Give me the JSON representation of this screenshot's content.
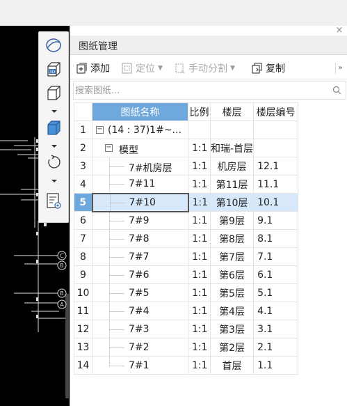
{
  "panel": {
    "title": "图纸管理",
    "close_glyph": "×"
  },
  "toolbar": {
    "add_label": "添加",
    "locate_label": "定位",
    "split_label": "手动分割",
    "copy_label": "复制",
    "more_glyph": "»"
  },
  "search": {
    "placeholder": "搜索图纸..."
  },
  "table": {
    "headers": {
      "name": "图纸名称",
      "scale": "比例",
      "floor": "楼层",
      "floor_no": "楼层编号"
    },
    "rows": [
      {
        "idx": "1",
        "name": "(14 : 37)1#~...",
        "scale": "",
        "floor": "",
        "floor_no": ""
      },
      {
        "idx": "2",
        "name": "模型",
        "scale": "1:1",
        "floor": "和瑞-首层",
        "floor_no": ""
      },
      {
        "idx": "3",
        "name": "7#机房层",
        "scale": "1:1",
        "floor": "机房层",
        "floor_no": "12.1"
      },
      {
        "idx": "4",
        "name": "7#11",
        "scale": "1:1",
        "floor": "第11层",
        "floor_no": "11.1"
      },
      {
        "idx": "5",
        "name": "7#10",
        "scale": "1:1",
        "floor": "第10层",
        "floor_no": "10.1"
      },
      {
        "idx": "6",
        "name": "7#9",
        "scale": "1:1",
        "floor": "第9层",
        "floor_no": "9.1"
      },
      {
        "idx": "7",
        "name": "7#8",
        "scale": "1:1",
        "floor": "第8层",
        "floor_no": "8.1"
      },
      {
        "idx": "8",
        "name": "7#7",
        "scale": "1:1",
        "floor": "第7层",
        "floor_no": "7.1"
      },
      {
        "idx": "9",
        "name": "7#6",
        "scale": "1:1",
        "floor": "第6层",
        "floor_no": "6.1"
      },
      {
        "idx": "10",
        "name": "7#5",
        "scale": "1:1",
        "floor": "第5层",
        "floor_no": "5.1"
      },
      {
        "idx": "11",
        "name": "7#4",
        "scale": "1:1",
        "floor": "第4层",
        "floor_no": "4.1"
      },
      {
        "idx": "12",
        "name": "7#3",
        "scale": "1:1",
        "floor": "第3层",
        "floor_no": "3.1"
      },
      {
        "idx": "13",
        "name": "7#2",
        "scale": "1:1",
        "floor": "第2层",
        "floor_no": "2.1"
      },
      {
        "idx": "14",
        "name": "7#1",
        "scale": "1:1",
        "floor": "首层",
        "floor_no": "1.1"
      }
    ]
  },
  "cad": {
    "axis_labels": [
      "C",
      "B",
      "B",
      "A"
    ]
  },
  "colors": {
    "header_blue": "#6fa8dc",
    "selected_row": "#d6e8fa"
  }
}
